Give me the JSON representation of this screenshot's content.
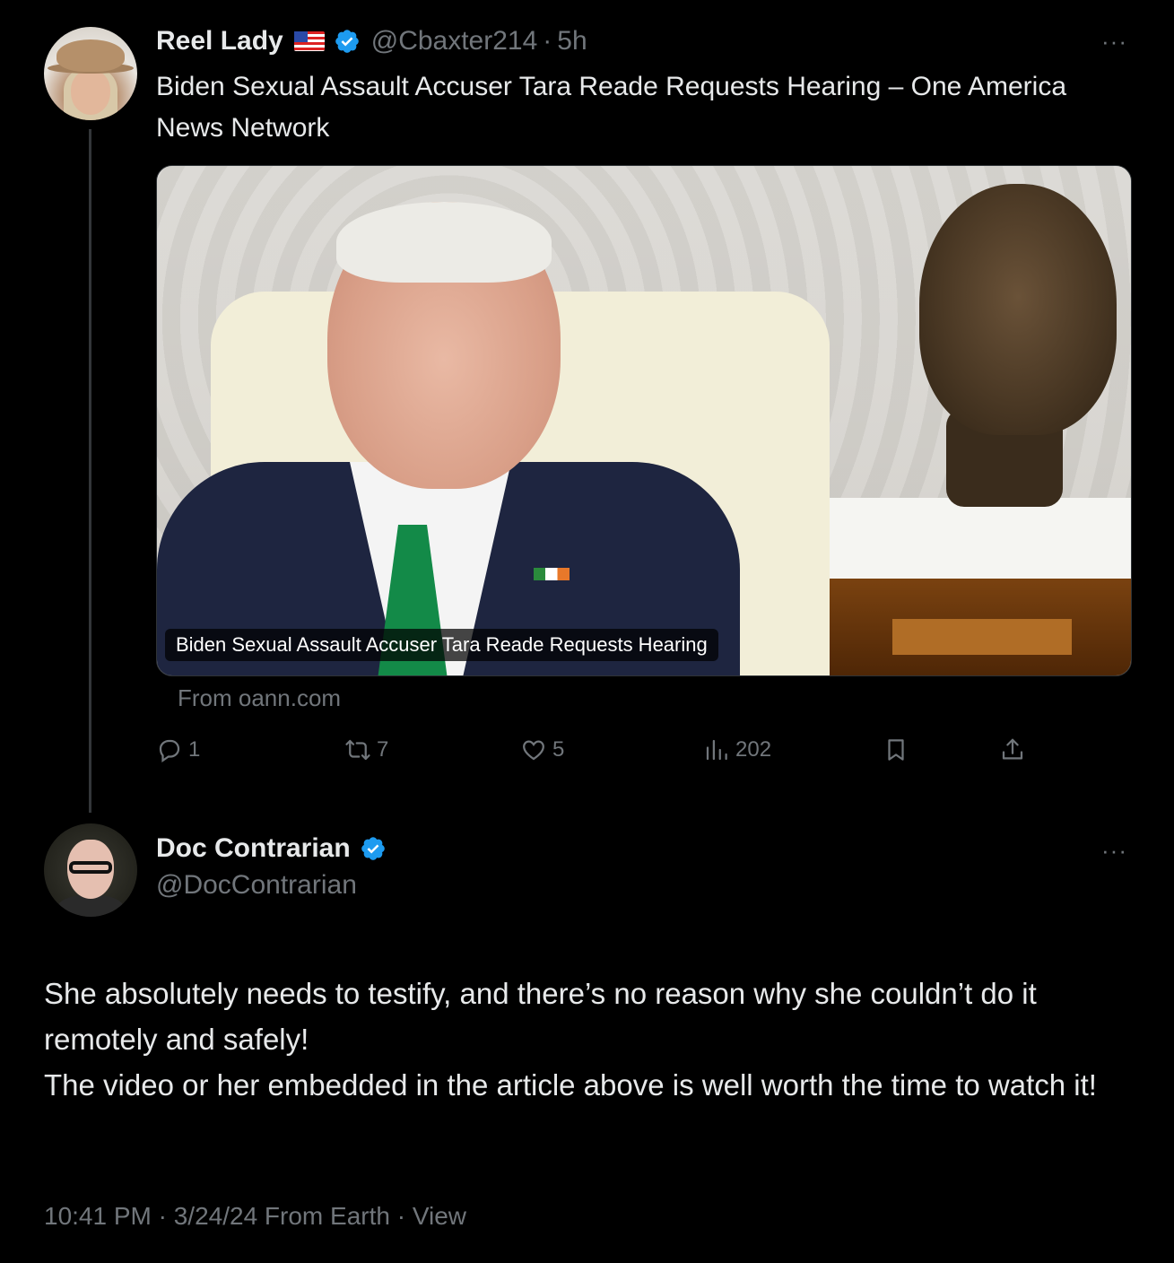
{
  "tweet1": {
    "display_name": "Reel Lady",
    "flag_icon": "us-flag-icon",
    "handle": "@Cbaxter214",
    "separator": "·",
    "time": "5h",
    "text": "Biden Sexual Assault Accuser Tara Reade Requests Hearing – One America News Network",
    "card": {
      "caption": "Biden Sexual Assault Accuser Tara Reade Requests Hearing",
      "source": "From oann.com"
    },
    "actions": {
      "replies": "1",
      "reposts": "7",
      "likes": "5",
      "views": "202"
    }
  },
  "tweet2": {
    "display_name": "Doc Contrarian",
    "handle": "@DocContrarian",
    "text_lines": [
      "She absolutely needs to testify, and there’s no reason why she couldn’t do it remotely and safely!",
      "The video or her embedded in the article above is well worth the time to watch it!"
    ],
    "meta": "10:41 PM · 3/24/24 From Earth · View"
  },
  "more_label": "···",
  "colors": {
    "background": "#000000",
    "text_primary": "#e7e9ea",
    "text_secondary": "#71767b",
    "verified_blue": "#1d9bf0",
    "thread_line": "#333639"
  }
}
